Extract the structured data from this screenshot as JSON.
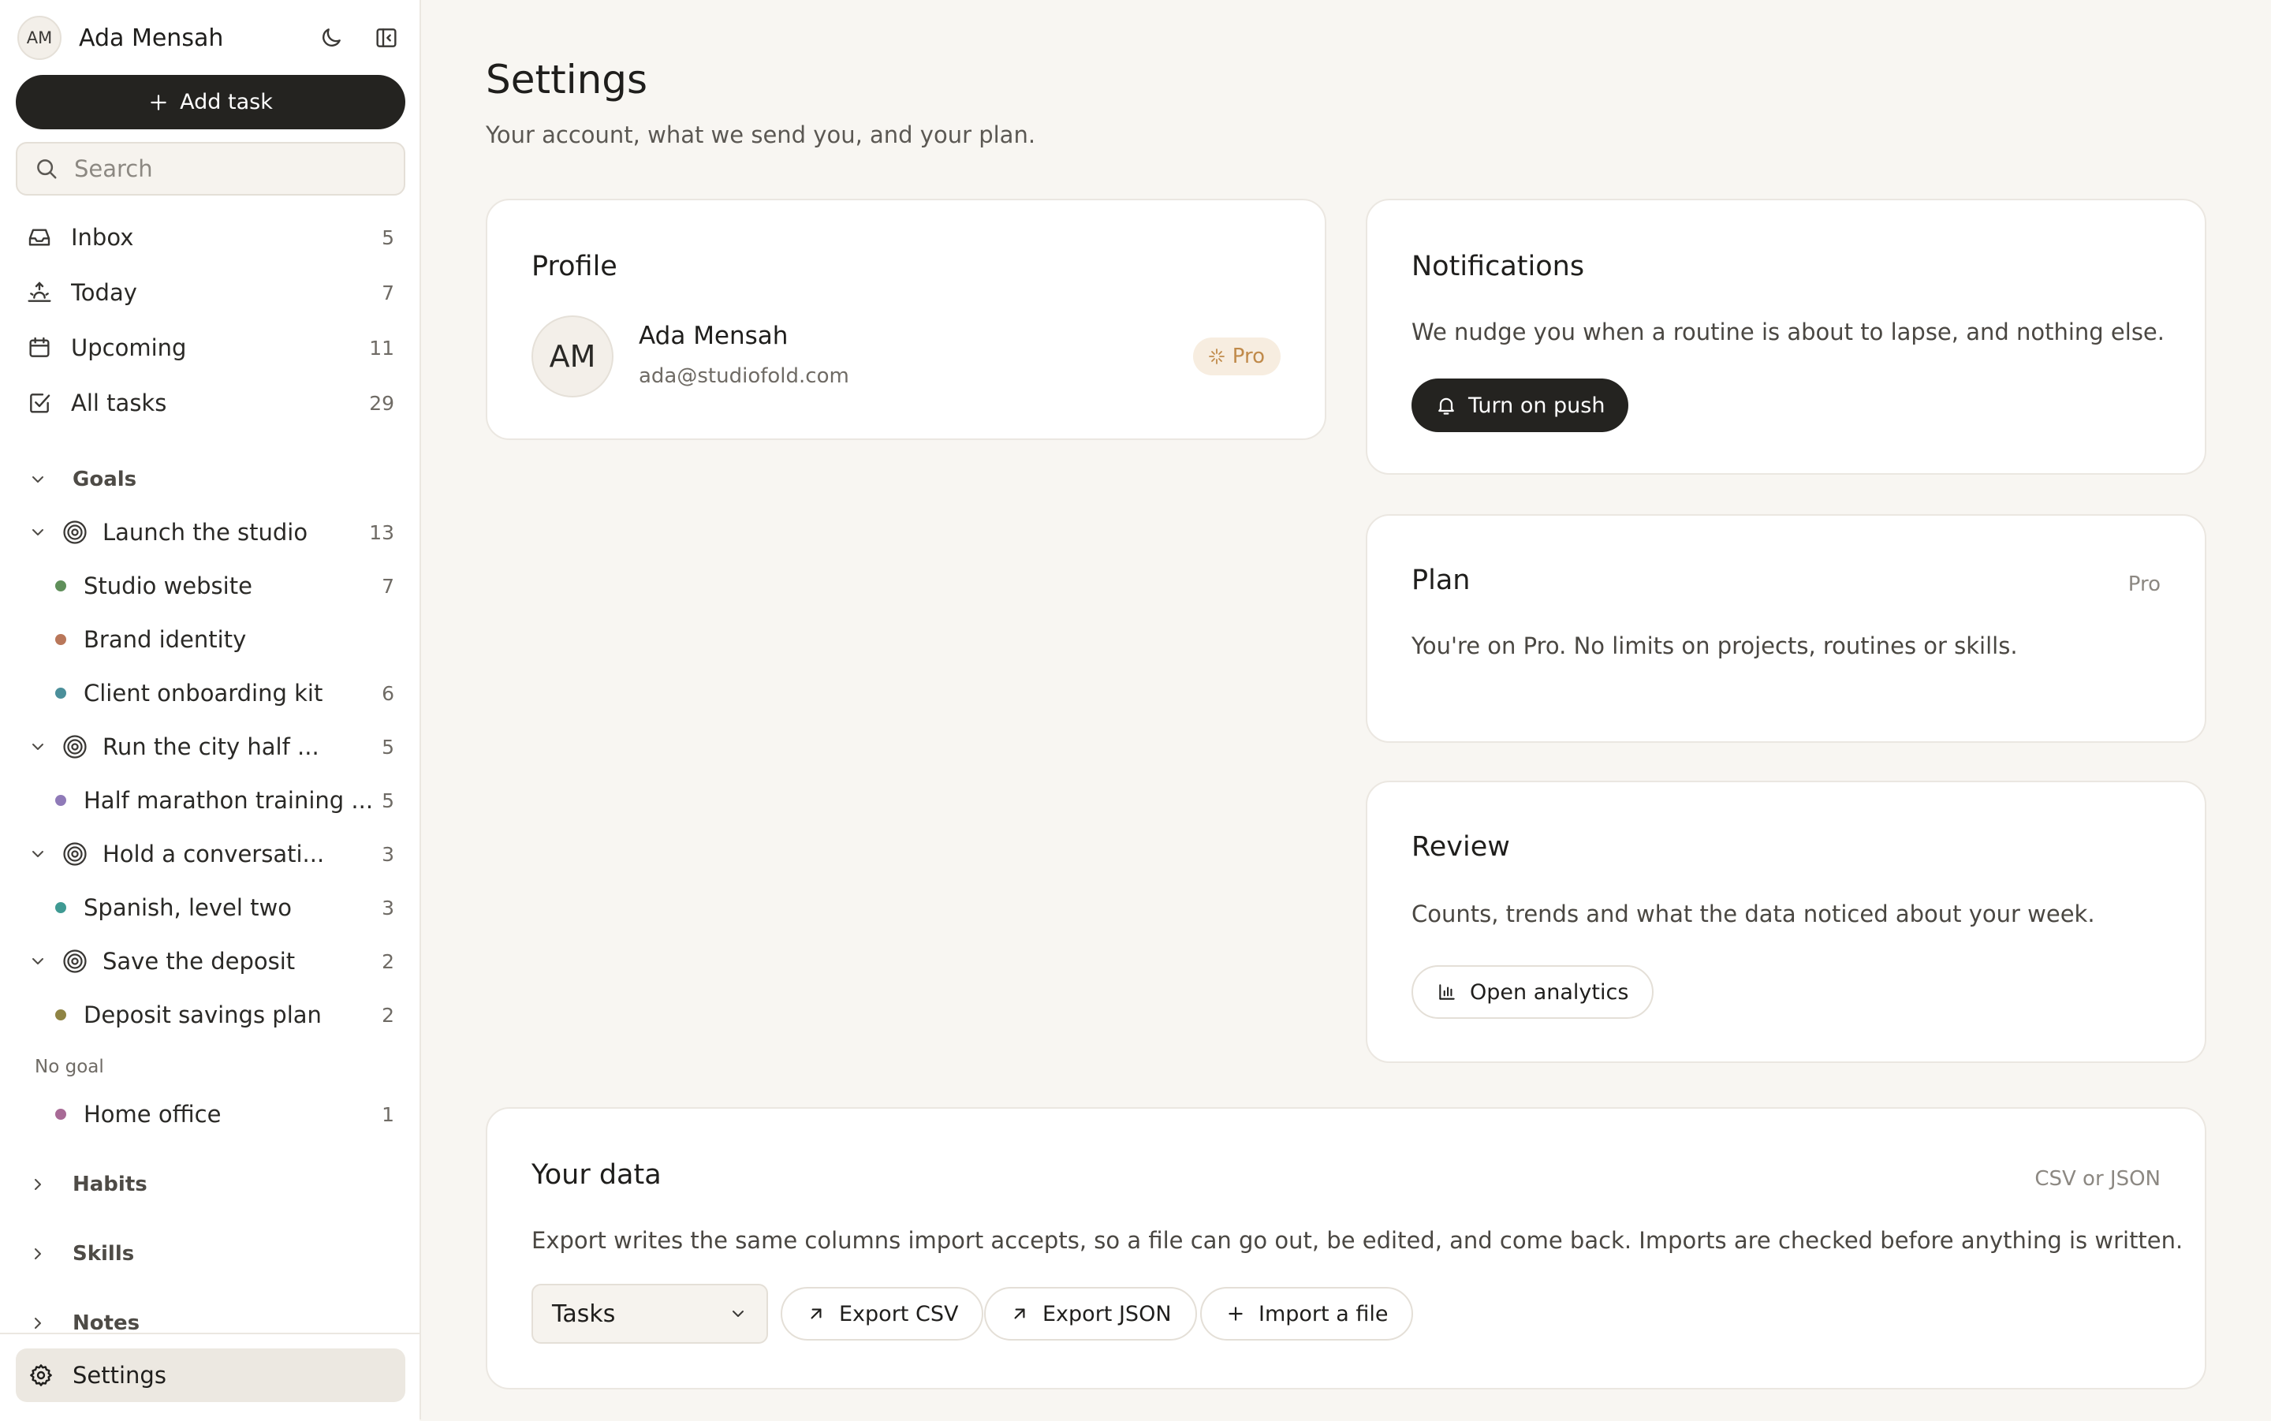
{
  "sidebar": {
    "user": {
      "initials": "AM",
      "name": "Ada Mensah"
    },
    "add_task_label": "Add task",
    "search_placeholder": "Search",
    "nav": [
      {
        "label": "Inbox",
        "count": "5",
        "icon": "inbox-icon"
      },
      {
        "label": "Today",
        "count": "7",
        "icon": "sunrise-icon"
      },
      {
        "label": "Upcoming",
        "count": "11",
        "icon": "calendar-icon"
      },
      {
        "label": "All tasks",
        "count": "29",
        "icon": "checkbox-icon"
      }
    ],
    "goals_label": "Goals",
    "goals": [
      {
        "label": "Launch the studio",
        "count": "13"
      },
      {
        "label": "Run the city half ...",
        "count": "5"
      },
      {
        "label": "Hold a conversati...",
        "count": "3"
      },
      {
        "label": "Save the deposit",
        "count": "2"
      }
    ],
    "projects": [
      {
        "label": "Studio website",
        "count": "7",
        "color": "#5f8f5a"
      },
      {
        "label": "Brand identity",
        "count": "",
        "color": "#b9775a"
      },
      {
        "label": "Client onboarding kit",
        "count": "6",
        "color": "#4b8f9a"
      },
      {
        "label": "Half marathon training ...",
        "count": "5",
        "color": "#8f7ab8"
      },
      {
        "label": "Spanish, level two",
        "count": "3",
        "color": "#3f9a93"
      },
      {
        "label": "Deposit savings plan",
        "count": "2",
        "color": "#8f8444"
      },
      {
        "label": "Home office",
        "count": "1",
        "color": "#a86a96"
      }
    ],
    "no_goal_label": "No goal",
    "habits_label": "Habits",
    "skills_label": "Skills",
    "notes_label": "Notes",
    "settings_label": "Settings"
  },
  "main": {
    "title": "Settings",
    "subtitle": "Your account, what we send you, and your plan.",
    "profile": {
      "title": "Profile",
      "initials": "AM",
      "name": "Ada Mensah",
      "email": "ada@studiofold.com",
      "badge": "Pro"
    },
    "notifications": {
      "title": "Notifications",
      "text": "We nudge you when a routine is about to lapse, and nothing else.",
      "button": "Turn on push"
    },
    "plan": {
      "title": "Plan",
      "meta": "Pro",
      "text": "You're on Pro. No limits on projects, routines or skills."
    },
    "review": {
      "title": "Review",
      "text": "Counts, trends and what the data noticed about your week.",
      "button": "Open analytics"
    },
    "data": {
      "title": "Your data",
      "meta": "CSV or JSON",
      "text": "Export writes the same columns import accepts, so a file can go out, be edited, and come back. Imports are checked before anything is written.",
      "select_value": "Tasks",
      "export_csv": "Export CSV",
      "export_json": "Export JSON",
      "import": "Import a file"
    }
  },
  "colors": {
    "accent_dark": "#242320",
    "pro_badge_text": "#c08a4a",
    "pro_badge_bg": "#f7ede0",
    "background": "#f8f6f2"
  }
}
